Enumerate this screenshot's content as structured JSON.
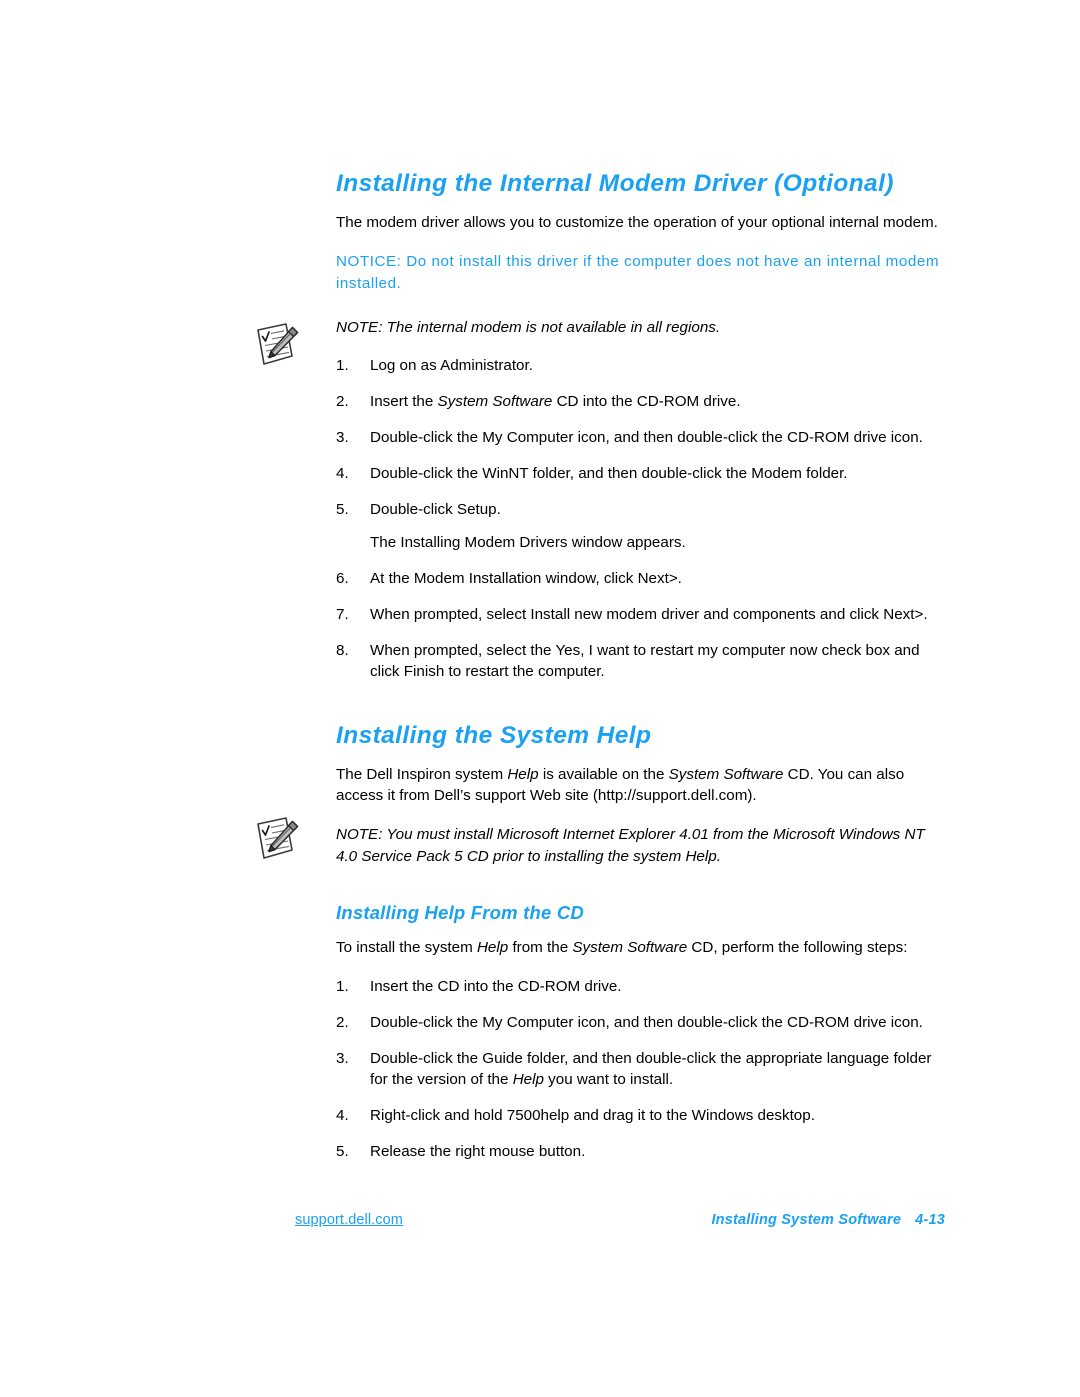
{
  "document": {
    "section1": {
      "heading": "Installing the Internal Modem Driver (Optional)",
      "intro": "The modem driver allows you to customize the operation of your optional internal modem.",
      "notice": "NOTICE: Do not install this driver if the computer does not have an internal modem installed.",
      "note": "NOTE: The internal modem is not available in all regions.",
      "note_icon": "note-pencil-icon",
      "steps": [
        {
          "num": "1.",
          "text": "Log on as Administrator."
        },
        {
          "num": "2.",
          "text_pre": "Insert the ",
          "text_em": "System Software",
          "text_post": " CD into the CD-ROM drive."
        },
        {
          "num": "3.",
          "text": "Double-click the My Computer icon, and then double-click the CD-ROM drive icon."
        },
        {
          "num": "4.",
          "text": "Double-click the WinNT folder, and then double-click the Modem folder."
        },
        {
          "num": "5.",
          "text": "Double-click Setup."
        },
        {
          "num": "",
          "text": "The Installing Modem Drivers window appears."
        },
        {
          "num": "6.",
          "text": "At the Modem Installation window, click Next>."
        },
        {
          "num": "7.",
          "text": "When prompted, select Install new modem driver and components and click Next>."
        },
        {
          "num": "8.",
          "text": "When prompted, select the Yes, I want to restart my computer now check box and click Finish to restart the computer."
        }
      ]
    },
    "section2": {
      "heading": "Installing the System Help",
      "intro_pre": "The Dell Inspiron system ",
      "intro_em1": "Help",
      "intro_mid": " is available on the ",
      "intro_em2": "System Software",
      "intro_post": " CD. You can also access it from Dell’s support Web site (http://support.dell.com).",
      "note": "NOTE: You must install Microsoft Internet Explorer 4.01 from the Microsoft Windows NT 4.0 Service Pack 5 CD prior to installing the system Help.",
      "note_icon": "note-pencil-icon",
      "subheading": "Installing Help From the CD",
      "sub_intro_pre": "To install the system ",
      "sub_intro_em1": "Help",
      "sub_intro_mid": " from the ",
      "sub_intro_em2": "System Software",
      "sub_intro_post": " CD, perform the following steps:",
      "steps": [
        {
          "num": "1.",
          "text": "Insert the CD into the CD-ROM drive."
        },
        {
          "num": "2.",
          "text": "Double-click the My Computer icon, and then double-click the CD-ROM drive icon."
        },
        {
          "num": "3.",
          "text_pre": "Double-click the Guide folder, and then double-click the appropriate language folder for the version of the ",
          "text_em": "Help",
          "text_post": " you want to install."
        },
        {
          "num": "4.",
          "text": "Right-click and hold 7500help and drag it to the Windows desktop."
        },
        {
          "num": "5.",
          "text": "Release the right mouse button."
        }
      ]
    },
    "footer": {
      "support_link": "support.dell.com",
      "chapter": "Installing System Software",
      "page_number": "4-13"
    },
    "colors": {
      "heading_blue": "#1ba1f2",
      "body_black": "#000000",
      "background": "#ffffff"
    }
  }
}
